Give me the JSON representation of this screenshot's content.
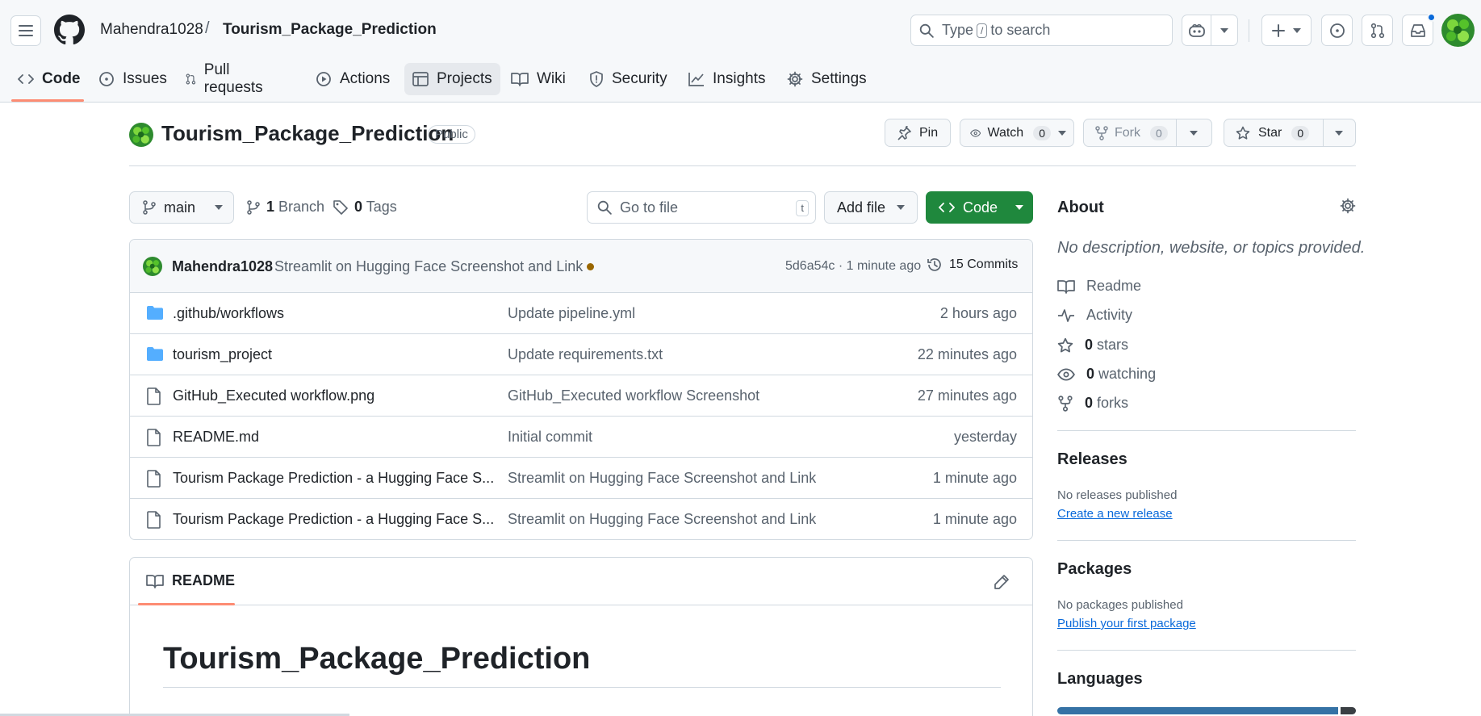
{
  "header": {
    "owner": "Mahendra1028",
    "separator": "/",
    "repo": "Tourism_Package_Prediction",
    "search_prefix": "Type",
    "search_key": "/",
    "search_suffix": "to search"
  },
  "nav": {
    "tabs": [
      {
        "label": "Code",
        "icon": "code-icon",
        "selected": true
      },
      {
        "label": "Issues",
        "icon": "issue-opened-icon"
      },
      {
        "label": "Pull requests",
        "icon": "git-pull-request-icon"
      },
      {
        "label": "Actions",
        "icon": "play-icon"
      },
      {
        "label": "Projects",
        "icon": "table-icon",
        "highlighted": true
      },
      {
        "label": "Wiki",
        "icon": "book-icon"
      },
      {
        "label": "Security",
        "icon": "shield-icon"
      },
      {
        "label": "Insights",
        "icon": "graph-icon"
      },
      {
        "label": "Settings",
        "icon": "gear-icon"
      }
    ]
  },
  "repo_header": {
    "title": "Tourism_Package_Prediction",
    "visibility": "Public",
    "pin_label": "Pin",
    "watch_label": "Watch",
    "watch_count": "0",
    "fork_label": "Fork",
    "fork_count": "0",
    "star_label": "Star",
    "star_count": "0"
  },
  "toolbar": {
    "branch": "main",
    "branch_count": "1",
    "branch_label": "Branch",
    "tag_count": "0",
    "tag_label": "Tags",
    "goto_placeholder": "Go to file",
    "goto_key": "t",
    "add_file_label": "Add file",
    "code_label": "Code"
  },
  "latest_commit": {
    "author": "Mahendra1028",
    "message": "Streamlit on Hugging Face Screenshot and Link",
    "hash_time": "5d6a54c · 1 minute ago",
    "commits_label": "15 Commits",
    "status_color": "#9a6700"
  },
  "files": [
    {
      "type": "folder",
      "name": ".github/workflows",
      "message": "Update pipeline.yml",
      "time": "2 hours ago"
    },
    {
      "type": "folder",
      "name": "tourism_project",
      "message": "Update requirements.txt",
      "time": "22 minutes ago"
    },
    {
      "type": "file",
      "name": "GitHub_Executed workflow.png",
      "message": "GitHub_Executed workflow Screenshot",
      "time": "27 minutes ago"
    },
    {
      "type": "file",
      "name": "README.md",
      "message": "Initial commit",
      "time": "yesterday"
    },
    {
      "type": "file",
      "name": "Tourism Package Prediction - a Hugging Face S...",
      "message": "Streamlit on Hugging Face Screenshot and Link",
      "time": "1 minute ago"
    },
    {
      "type": "file",
      "name": "Tourism Package Prediction - a Hugging Face S...",
      "message": "Streamlit on Hugging Face Screenshot and Link",
      "time": "1 minute ago"
    }
  ],
  "readme": {
    "tab_label": "README",
    "heading": "Tourism_Package_Prediction"
  },
  "sidebar": {
    "about_title": "About",
    "about_desc": "No description, website, or topics provided.",
    "items": [
      {
        "icon": "book-icon",
        "count": "",
        "label": "Readme"
      },
      {
        "icon": "pulse-icon",
        "count": "",
        "label": "Activity"
      },
      {
        "icon": "star-icon",
        "count": "0",
        "label": "stars"
      },
      {
        "icon": "eye-icon",
        "count": "0",
        "label": "watching"
      },
      {
        "icon": "repo-forked-icon",
        "count": "0",
        "label": "forks"
      }
    ],
    "releases_title": "Releases",
    "releases_text": "No releases published",
    "releases_link": "Create a new release",
    "packages_title": "Packages",
    "packages_text": "No packages published",
    "packages_link": "Publish your first package",
    "languages_title": "Languages"
  },
  "colors": {
    "accent_green": "#1f883d",
    "link_blue": "#0969da",
    "tab_underline": "#fd8c73",
    "lang_primary": "#3572A5",
    "lang_secondary": "#3a3f44"
  }
}
